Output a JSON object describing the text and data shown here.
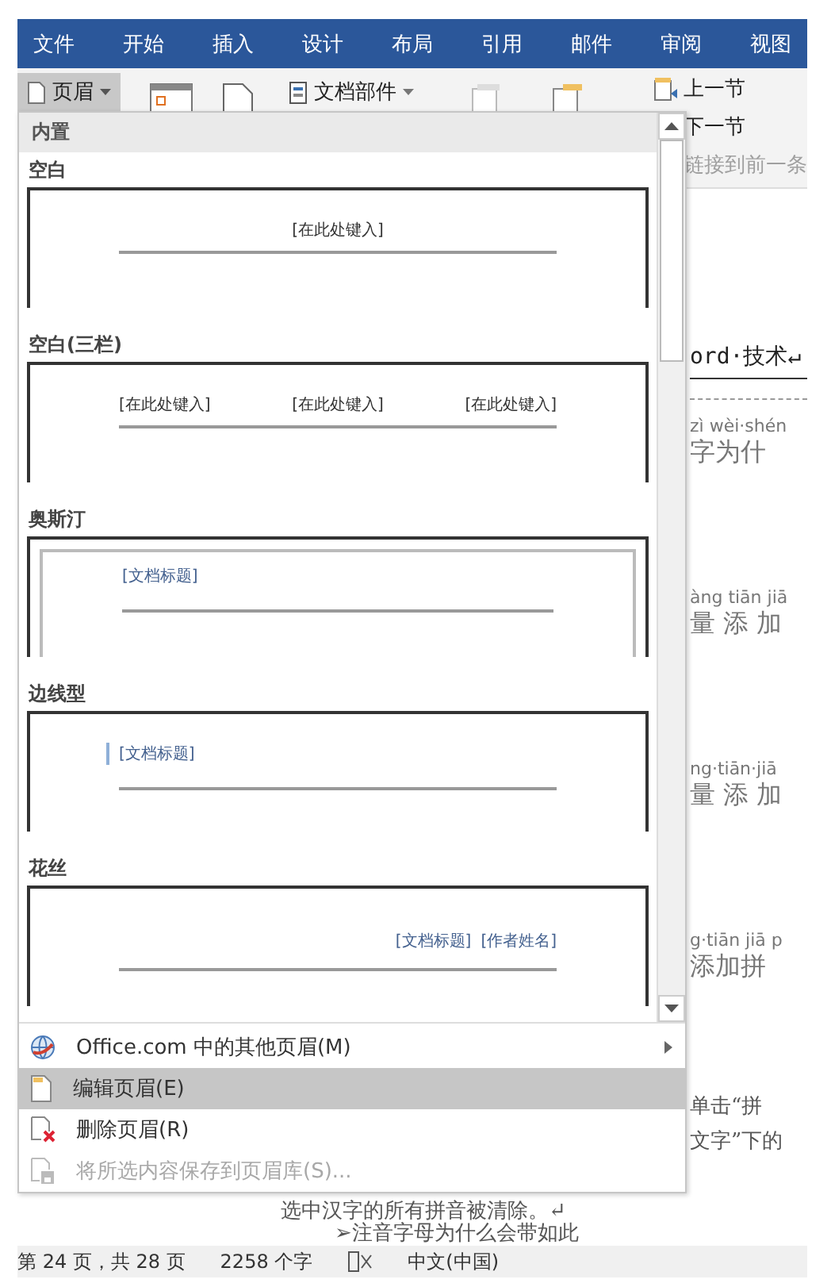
{
  "ribbon_tabs": [
    "文件",
    "开始",
    "插入",
    "设计",
    "布局",
    "引用",
    "邮件",
    "审阅",
    "视图"
  ],
  "ribbon": {
    "header_button": {
      "label": "页眉",
      "selected": true
    },
    "doc_parts": "文档部件",
    "nav": [
      {
        "label": "上一节",
        "disabled": false
      },
      {
        "label": "下一节",
        "disabled": false
      },
      {
        "label": "链接到前一条",
        "disabled": true
      }
    ]
  },
  "dropdown": {
    "section": "内置",
    "gallery": [
      {
        "name": "空白",
        "kind": "blank",
        "placeholders": [
          "[在此处键入]"
        ]
      },
      {
        "name": "空白(三栏)",
        "kind": "three",
        "placeholders": [
          "[在此处键入]",
          "[在此处键入]",
          "[在此处键入]"
        ]
      },
      {
        "name": "奥斯汀",
        "kind": "austin",
        "placeholders": [
          "[文档标题]"
        ]
      },
      {
        "name": "边线型",
        "kind": "sideline",
        "placeholders": [
          "[文档标题]"
        ]
      },
      {
        "name": "花丝",
        "kind": "filigree",
        "placeholders": [
          "[文档标题]",
          "[作者姓名]"
        ]
      }
    ],
    "menu": [
      {
        "label": "Office.com 中的其他页眉(M)",
        "submenu": true,
        "selected": false,
        "disabled": false
      },
      {
        "label": "编辑页眉(E)",
        "submenu": false,
        "selected": true,
        "disabled": false
      },
      {
        "label": "删除页眉(R)",
        "submenu": false,
        "selected": false,
        "disabled": false
      },
      {
        "label": "将所选内容保存到页眉库(S)...",
        "submenu": false,
        "selected": false,
        "disabled": true
      }
    ]
  },
  "document": {
    "heading": "ord·技术↵",
    "blocks": [
      {
        "pinyin": "zì wèi·shén",
        "hanzi": "字为什"
      },
      {
        "pinyin": "àng tiān jiā",
        "hanzi": "量 添 加"
      },
      {
        "pinyin": "ng·tiān·jiā",
        "hanzi": "量 添 加"
      },
      {
        "pinyin": "g·tiān jiā p",
        "hanzi": "添加拼"
      }
    ],
    "side_lines": [
      "单击“拼",
      "文字”下的"
    ],
    "lines": [
      "选中汉字的所有拼音被清除。↵",
      "➢注音字母为什么会带如此"
    ]
  },
  "status_bar": {
    "page": "第 24 页，共 28 页",
    "words": "2258 个字",
    "language": "中文(中国)"
  }
}
